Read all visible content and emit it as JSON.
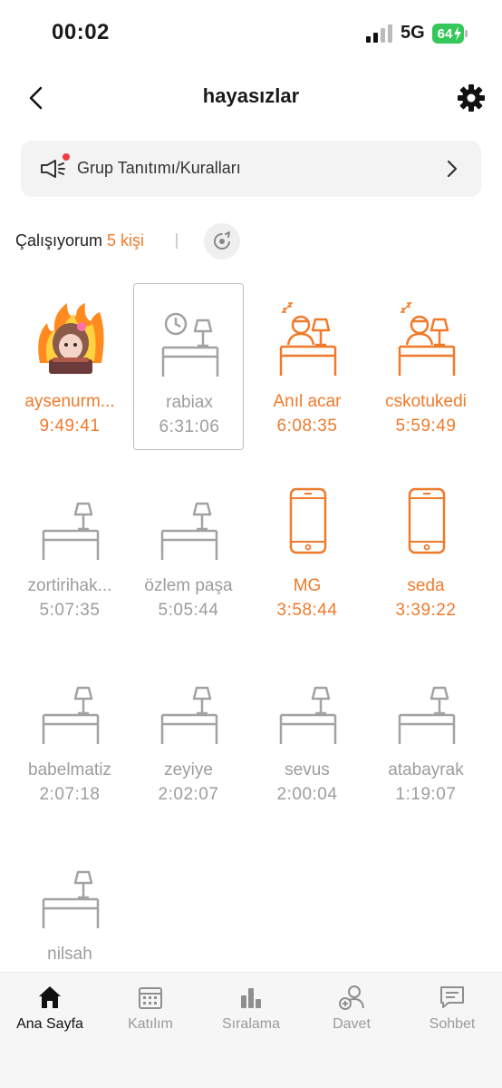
{
  "status_bar": {
    "time": "00:02",
    "network": "5G",
    "battery": "64"
  },
  "nav": {
    "title": "hayasızlar"
  },
  "rules_banner": {
    "label": "Grup Tanıtımı/Kuralları"
  },
  "working": {
    "label": "Çalışıyorum",
    "count": "5 kişi"
  },
  "members": [
    {
      "name": "aysenurm...",
      "time": "9:49:41",
      "state": "active",
      "icon": "avatar-fire"
    },
    {
      "name": "rabiax",
      "time": "6:31:06",
      "state": "idle",
      "icon": "desk-clock-icon",
      "selected": true
    },
    {
      "name": "Anıl acar",
      "time": "6:08:35",
      "state": "active",
      "icon": "sleeping-person-desk-icon"
    },
    {
      "name": "cskotukedi",
      "time": "5:59:49",
      "state": "active",
      "icon": "sleeping-person-desk-icon"
    },
    {
      "name": "zortirihak...",
      "time": "5:07:35",
      "state": "idle",
      "icon": "empty-desk-icon"
    },
    {
      "name": "özlem paşa",
      "time": "5:05:44",
      "state": "idle",
      "icon": "empty-desk-icon"
    },
    {
      "name": "MG",
      "time": "3:58:44",
      "state": "active",
      "icon": "phone-icon"
    },
    {
      "name": "seda",
      "time": "3:39:22",
      "state": "active",
      "icon": "phone-icon"
    },
    {
      "name": "babelmatiz",
      "time": "2:07:18",
      "state": "idle",
      "icon": "empty-desk-icon"
    },
    {
      "name": "zeyiye",
      "time": "2:02:07",
      "state": "idle",
      "icon": "empty-desk-icon"
    },
    {
      "name": "sevus",
      "time": "2:00:04",
      "state": "idle",
      "icon": "empty-desk-icon"
    },
    {
      "name": "atabayrak",
      "time": "1:19:07",
      "state": "idle",
      "icon": "empty-desk-icon"
    },
    {
      "name": "nilsah",
      "time": "",
      "state": "idle",
      "icon": "empty-desk-icon"
    }
  ],
  "tabs": [
    {
      "label": "Ana Sayfa",
      "icon": "home-icon",
      "active": true
    },
    {
      "label": "Katılım",
      "icon": "calendar-icon",
      "active": false
    },
    {
      "label": "Sıralama",
      "icon": "bar-chart-icon",
      "active": false
    },
    {
      "label": "Davet",
      "icon": "add-user-icon",
      "active": false
    },
    {
      "label": "Sohbet",
      "icon": "chat-icon",
      "active": false
    }
  ],
  "colors": {
    "accent": "#f07a2a",
    "idle": "#9d9d9d",
    "notification_dot": "#f23b3b",
    "battery": "#34c759"
  }
}
